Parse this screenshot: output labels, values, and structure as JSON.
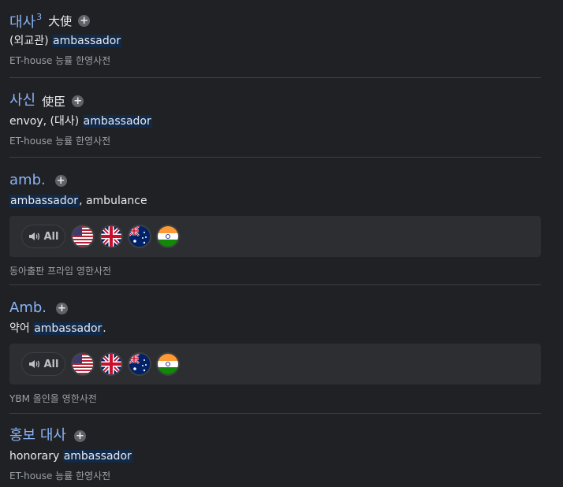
{
  "entries": [
    {
      "headword": "대사",
      "superscript": "3",
      "hanja": "大使",
      "definition_pre": "(외교관) ",
      "definition_hl": "ambassador",
      "definition_post": "",
      "source": "ET-house 능률 한영사전"
    },
    {
      "headword": "사신",
      "hanja": "使臣",
      "definition_pre": "envoy, (대사) ",
      "definition_hl": "ambassador",
      "definition_post": "",
      "source": "ET-house 능률 한영사전"
    },
    {
      "headword": "amb.",
      "definition_pre": "",
      "definition_hl": "ambassador",
      "definition_post": ", ambulance",
      "audio_all_label": "All",
      "source": "동아출판 프라임 영한사전"
    },
    {
      "headword": "Amb.",
      "definition_pre": "약어 ",
      "definition_hl": "ambassador",
      "definition_post": ".",
      "audio_all_label": "All",
      "source": "YBM 올인올 영한사전"
    },
    {
      "headword": "홍보 대사",
      "definition_pre": "honorary ",
      "definition_hl": "ambassador",
      "definition_post": "",
      "source": "ET-house 능률 한영사전"
    }
  ],
  "icons": {
    "plus": "plus-icon",
    "speaker": "speaker-icon",
    "flags": [
      "us-flag-icon",
      "uk-flag-icon",
      "australia-flag-icon",
      "india-flag-icon"
    ]
  },
  "colors": {
    "background": "#202124",
    "headword": "#8ab4f8",
    "highlight": "#122a4a",
    "source": "#9aa0a6",
    "divider": "#3c4043",
    "audio_bar": "#2d2e31"
  }
}
